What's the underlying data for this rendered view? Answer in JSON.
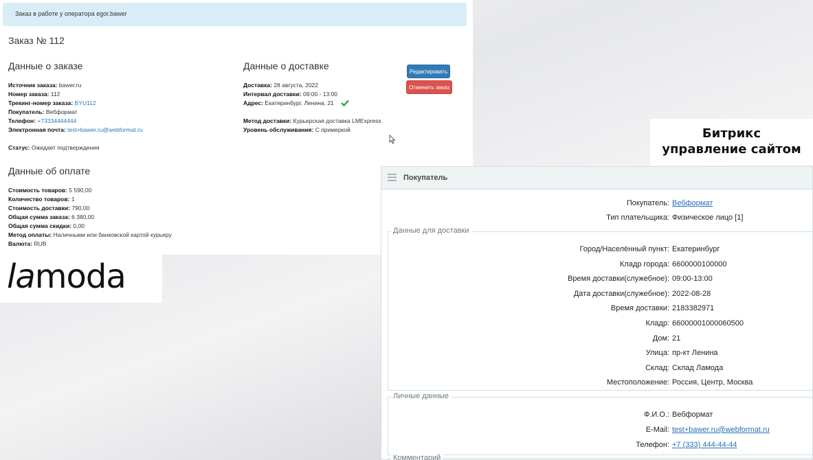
{
  "alert": {
    "text": "Заказ в работе у оператора egor.bawer"
  },
  "order": {
    "title": "Заказ № 112",
    "details": {
      "heading": "Данные о заказе",
      "fields": [
        {
          "label": "Источник заказа:",
          "value": "bawer.ru"
        },
        {
          "label": "Номер заказа:",
          "value": "112"
        },
        {
          "label": "Трекинг-номер заказа:",
          "value": "BYU112"
        },
        {
          "label": "Покупатель:",
          "value": "Вебформат"
        },
        {
          "label": "Телефон:",
          "value": "+73334444444"
        },
        {
          "label": "Электронная почта:",
          "value": "test+bawer.ru@webformat.ru"
        }
      ],
      "status": {
        "label": "Статус:",
        "value": "Ожидает подтверждения"
      }
    },
    "delivery": {
      "heading": "Данные о доставке",
      "fields": [
        {
          "label": "Доставка:",
          "value": "28 августа, 2022"
        },
        {
          "label": "Интервал доставки:",
          "value": "09:00 - 13:00"
        },
        {
          "label": "Адрес:",
          "value": "Екатеринбург, Ленина, 21"
        }
      ],
      "method": {
        "label": "Метод доставки:",
        "value": "Курьерская доставка LMExpress"
      },
      "service": {
        "label": "Уровень обслуживания:",
        "value": "С примеркой"
      }
    },
    "payment": {
      "heading": "Данные об оплате",
      "fields": [
        {
          "label": "Стоимость товаров:",
          "value": "5 590,00"
        },
        {
          "label": "Количество товаров:",
          "value": "1"
        },
        {
          "label": "Стоимость доставки:",
          "value": "790,00"
        },
        {
          "label": "Общая сумма заказа:",
          "value": "6 380,00"
        },
        {
          "label": "Общая сумма скидки:",
          "value": "0,00"
        },
        {
          "label": "Метод оплаты:",
          "value": "Наличными или банковской картой курьеру"
        },
        {
          "label": "Валюта:",
          "value": "RUB"
        }
      ]
    },
    "buttons": {
      "edit": "Редактировать",
      "cancel": "Отменить заказ"
    }
  },
  "lamoda": {
    "prefix": "la",
    "suffix": "moda"
  },
  "bitrix_caption": {
    "line1": "Битрикс",
    "line2": "управление сайтом"
  },
  "buyer_panel": {
    "title": "Покупатель",
    "top": [
      {
        "label": "Покупатель:",
        "value": "Вебформат"
      },
      {
        "label": "Тип плательщика:",
        "value": "Физическое лицо [1]"
      }
    ],
    "delivery_section": {
      "title": "Данные для доставки",
      "rows": [
        {
          "label": "Город/Населённый пункт:",
          "value": "Екатеринбург"
        },
        {
          "label": "Кладр города:",
          "value": "6600000100000"
        },
        {
          "label": "Время доставки(служебное):",
          "value": "09:00-13:00"
        },
        {
          "label": "Дата доставки(служебное):",
          "value": "2022-08-28"
        },
        {
          "label": "Время доставки:",
          "value": "2183382971"
        },
        {
          "label": "Кладр:",
          "value": "66000001000060500"
        },
        {
          "label": "Дом:",
          "value": "21"
        },
        {
          "label": "Улица:",
          "value": "пр-кт Ленина"
        },
        {
          "label": "Склад:",
          "value": "Склад Ламода"
        },
        {
          "label": "Местоположение:",
          "value": "Россия, Центр, Москва"
        }
      ]
    },
    "personal_section": {
      "title": "Личные данные",
      "rows": [
        {
          "label": "Ф.И.О.:",
          "value": "Вебформат"
        },
        {
          "label": "E-Mail:",
          "value": "test+bawer.ru@webformat.ru"
        },
        {
          "label": "Телефон:",
          "value": "+7 (333) 444-44-44"
        }
      ]
    },
    "comment_section": {
      "title": "Комментарий"
    }
  },
  "colors": {
    "primary": "#337ab7",
    "danger": "#d9534f",
    "alert_bg": "#d9edf7",
    "link": "#2a7ab8",
    "success": "#3aa14a"
  }
}
